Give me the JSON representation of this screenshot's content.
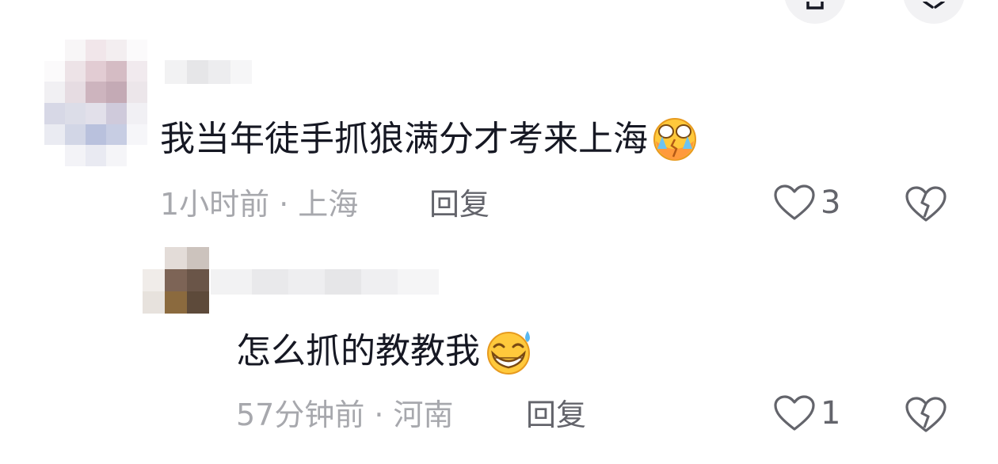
{
  "comments": [
    {
      "text": "我当年徒手抓狼满分才考来上海",
      "emoji": "crying-face",
      "time": "1小时前",
      "location": "上海",
      "reply_label": "回复",
      "likes": "3"
    },
    {
      "text": "怎么抓的教教我",
      "emoji": "grinning-sweat-face",
      "time": "57分钟前",
      "location": "河南",
      "reply_label": "回复",
      "likes": "1"
    }
  ],
  "separator": "·",
  "colors": {
    "text": "#161823",
    "meta": "#a7a8ad",
    "secondary": "#63646b",
    "icon": "#63646b"
  }
}
